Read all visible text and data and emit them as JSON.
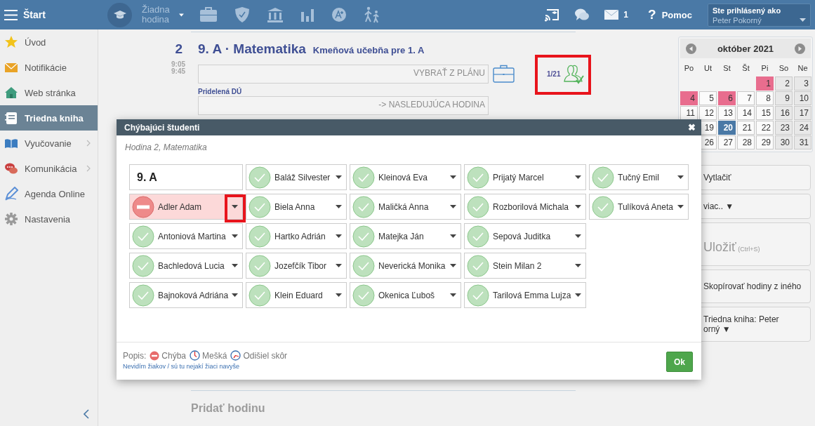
{
  "topbar": {
    "menu_label": "Štart",
    "lesson_picker": "Žiadna hodina",
    "messages_count": "1",
    "help_icon": "?",
    "help_label": "Pomoc",
    "user": {
      "caption": "Ste prihlásený ako",
      "name": "Peter Pokorný"
    }
  },
  "sidebar": {
    "items": [
      {
        "label": "Úvod",
        "selected": false,
        "expandable": false
      },
      {
        "label": "Notifikácie",
        "selected": false,
        "expandable": false
      },
      {
        "label": "Web stránka",
        "selected": false,
        "expandable": false
      },
      {
        "label": "Triedna kniha",
        "selected": true,
        "expandable": false
      },
      {
        "label": "Vyučovanie",
        "selected": false,
        "expandable": true
      },
      {
        "label": "Komunikácia",
        "selected": false,
        "expandable": true
      },
      {
        "label": "Agenda Online",
        "selected": false,
        "expandable": false
      },
      {
        "label": "Nastavenia",
        "selected": false,
        "expandable": false
      }
    ]
  },
  "lesson": {
    "number": "2",
    "title": "9. A · Matematika",
    "room": "Kmeňová učebňa pre 1. A",
    "start": "9:05",
    "end": "9:45",
    "topic_button": "VYBRAŤ Z PLÁNU",
    "homework_label": "Pridelená DÚ",
    "homework_button": "-> NASLEDUJÚCA HODINA",
    "attendance": "1/21",
    "add_lesson": "Pridať hodinu"
  },
  "calendar": {
    "month": "október 2021",
    "weekdays": [
      "Po",
      "Ut",
      "St",
      "Št",
      "Pi",
      "So",
      "Ne"
    ],
    "weeks": [
      [
        {
          "kind": "empty"
        },
        {
          "kind": "empty"
        },
        {
          "kind": "empty"
        },
        {
          "kind": "empty"
        },
        {
          "kind": "day",
          "day": "1",
          "marked": true,
          "selected": false
        },
        {
          "kind": "day",
          "day": "2",
          "marked": false,
          "selected": false
        },
        {
          "kind": "day",
          "day": "3",
          "marked": false,
          "selected": false
        }
      ],
      [
        {
          "kind": "day",
          "day": "4",
          "marked": true,
          "selected": false
        },
        {
          "kind": "day",
          "day": "5",
          "marked": false,
          "selected": false
        },
        {
          "kind": "day",
          "day": "6",
          "marked": true,
          "selected": false
        },
        {
          "kind": "day",
          "day": "7",
          "marked": false,
          "selected": false
        },
        {
          "kind": "day",
          "day": "8",
          "marked": false,
          "selected": false
        },
        {
          "kind": "day",
          "day": "9",
          "marked": false,
          "selected": false
        },
        {
          "kind": "day",
          "day": "10",
          "marked": false,
          "selected": false
        }
      ],
      [
        {
          "kind": "day",
          "day": "11",
          "marked": false,
          "selected": false
        },
        {
          "kind": "day",
          "day": "12",
          "marked": false,
          "selected": false
        },
        {
          "kind": "day",
          "day": "13",
          "marked": false,
          "selected": false
        },
        {
          "kind": "day",
          "day": "14",
          "marked": false,
          "selected": false
        },
        {
          "kind": "day",
          "day": "15",
          "marked": false,
          "selected": false
        },
        {
          "kind": "day",
          "day": "16",
          "marked": false,
          "selected": false
        },
        {
          "kind": "day",
          "day": "17",
          "marked": false,
          "selected": false
        }
      ],
      [
        {
          "kind": "covered"
        },
        {
          "kind": "day",
          "day": "19",
          "marked": false,
          "selected": false
        },
        {
          "kind": "day",
          "day": "20",
          "marked": false,
          "selected": true
        },
        {
          "kind": "day",
          "day": "21",
          "marked": false,
          "selected": false
        },
        {
          "kind": "day",
          "day": "22",
          "marked": false,
          "selected": false
        },
        {
          "kind": "day",
          "day": "23",
          "marked": false,
          "selected": false
        },
        {
          "kind": "day",
          "day": "24",
          "marked": false,
          "selected": false
        }
      ],
      [
        {
          "kind": "covered"
        },
        {
          "kind": "day",
          "day": "26",
          "marked": false,
          "selected": false
        },
        {
          "kind": "day",
          "day": "27",
          "marked": false,
          "selected": false
        },
        {
          "kind": "day",
          "day": "28",
          "marked": false,
          "selected": false
        },
        {
          "kind": "day",
          "day": "29",
          "marked": false,
          "selected": false
        },
        {
          "kind": "day",
          "day": "30",
          "marked": false,
          "selected": false
        },
        {
          "kind": "day",
          "day": "31",
          "marked": false,
          "selected": false
        }
      ]
    ]
  },
  "actions": [
    {
      "kind": "plain",
      "lines": [
        "Vytlačiť"
      ]
    },
    {
      "kind": "plain",
      "lines": [
        "viac.. ▼"
      ]
    },
    {
      "kind": "save",
      "lines": [
        "Uložiť"
      ],
      "hint": "(Ctrl+S)"
    },
    {
      "kind": "plain",
      "lines": [
        "Skopírovať hodiny z iného"
      ]
    },
    {
      "kind": "plain",
      "lines": [
        "Triedna kniha: Peter",
        "orný ▼"
      ]
    }
  ],
  "modal": {
    "title": "Chýbajúci študenti",
    "close": "✖",
    "subtitle": "Hodina 2, Matematika",
    "class_label": "9. A",
    "students": [
      {
        "name": "Adler Adam",
        "absent": true
      },
      {
        "name": "Antoniová Martina",
        "absent": false
      },
      {
        "name": "Bachledová Lucia",
        "absent": false
      },
      {
        "name": "Bajnoková Adriána",
        "absent": false
      },
      {
        "name": "Baláž Silvester",
        "absent": false
      },
      {
        "name": "Biela Anna",
        "absent": false
      },
      {
        "name": "Hartko Adrián",
        "absent": false
      },
      {
        "name": "Jozefčík Tibor",
        "absent": false
      },
      {
        "name": "Klein Eduard",
        "absent": false
      },
      {
        "name": "Kleinová Eva",
        "absent": false
      },
      {
        "name": "Maličká Anna",
        "absent": false
      },
      {
        "name": "Matejka Ján",
        "absent": false
      },
      {
        "name": "Neverická Monika",
        "absent": false
      },
      {
        "name": "Okenica Ľuboš",
        "absent": false
      },
      {
        "name": "Prijatý Marcel",
        "absent": false
      },
      {
        "name": "Rozborilová Michala",
        "absent": false
      },
      {
        "name": "Sepová Juditka",
        "absent": false
      },
      {
        "name": "Stein Milan 2",
        "absent": false
      },
      {
        "name": "Tarilová Emma Lujza",
        "absent": false
      },
      {
        "name": "Tučný Emil",
        "absent": false
      },
      {
        "name": "Tulíková Aneta",
        "absent": false
      }
    ],
    "legend_label": "Popis:",
    "legend": [
      {
        "kind": "absent",
        "label": "Chýba"
      },
      {
        "kind": "late",
        "label": "Mešká"
      },
      {
        "kind": "left_early",
        "label": "Odišiel skôr"
      }
    ],
    "link": "Nevidím žiakov / sú tu nejakí žiaci navyše",
    "ok": "Ok"
  }
}
